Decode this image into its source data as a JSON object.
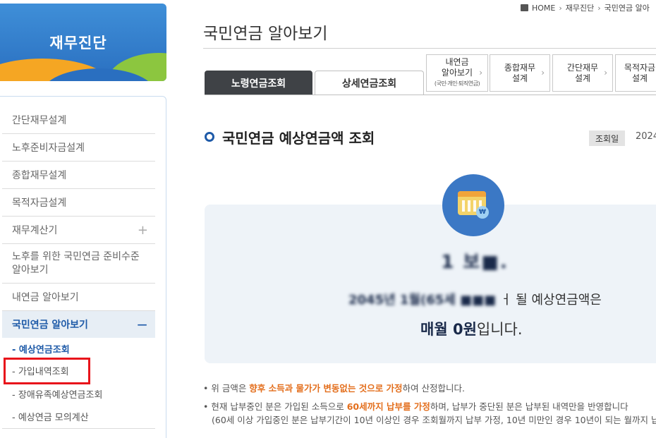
{
  "sidebar": {
    "banner_title": "재무진단",
    "items": [
      {
        "label": "간단재무설계"
      },
      {
        "label": "노후준비자금설계"
      },
      {
        "label": "종합재무설계"
      },
      {
        "label": "목적자금설계"
      },
      {
        "label": "재무계산기",
        "toggle": "+"
      },
      {
        "label": "노후를 위한 국민연금 준비수준 알아보기"
      },
      {
        "label": "내연금 알아보기"
      },
      {
        "label": "국민연금 알아보기",
        "toggle": "−",
        "active": true
      }
    ],
    "sub_items": [
      {
        "label": "- 예상연금조회",
        "current": true
      },
      {
        "label": "- 가입내역조회"
      },
      {
        "label": "- 장애유족예상연금조회"
      },
      {
        "label": "- 예상연금 모의계산"
      }
    ]
  },
  "breadcrumb": [
    "HOME",
    "재무진단",
    "국민연금 알아"
  ],
  "page_title": "국민연금 알아보기",
  "tabs": [
    {
      "label": "노령연금조회",
      "active": true
    },
    {
      "label": "상세연금조회",
      "active": false
    }
  ],
  "quick_links": [
    {
      "line1": "내연금",
      "line2": "알아보기",
      "small": "(국민·개인·퇴직연금)"
    },
    {
      "line1": "종합재무",
      "line2": "설계"
    },
    {
      "line1": "간단재무",
      "line2": "설계"
    },
    {
      "line1": "목적자금",
      "line2": "설계"
    }
  ],
  "section": {
    "title": "국민연금 예상연금액 조회",
    "date_label": "조회일",
    "date_value": "2024"
  },
  "result": {
    "name_masked": "1 보■.",
    "msg_masked": "2045년 1월(65",
    "msg_masked_tail": "세 ■■■",
    "msg_suffix": "ㅓ 될 예상연금액은",
    "amount_prefix": "매월 ",
    "amount": "0원",
    "amount_suffix": "입니다."
  },
  "notes": {
    "note1_a": "• 위 금액은 ",
    "note1_emph": "향후 소득과 물가가 변동없는 것으로 가정",
    "note1_b": "하여 산정합니다.",
    "note2_a": "• 현재 납부중인 분은 가입된 소득으로 ",
    "note2_emph": "60세까지 납부를 가정",
    "note2_b": "하며, 납부가 중단된 분은 납부된 내역만을 반영합니다",
    "note3": "(60세 이상 가입중인 분은 납부기간이 10년 이상인 경우 조회월까지 납부 가정, 10년 미만인 경우 10년이 되는 월까지 납부"
  },
  "colors": {
    "brand_blue": "#1e5aa8",
    "accent_orange": "#e36e1c",
    "highlight_red": "#e8141b"
  }
}
